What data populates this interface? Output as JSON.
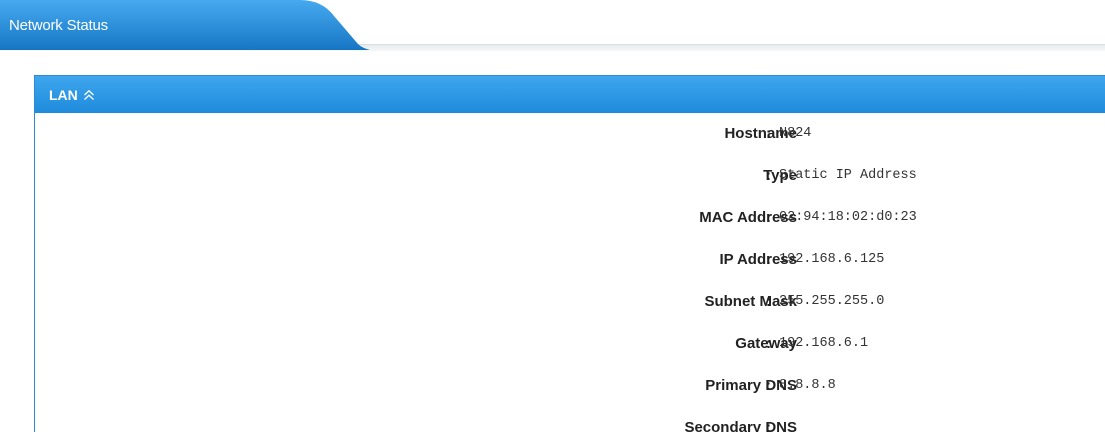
{
  "tab": {
    "label": "Network Status"
  },
  "panel": {
    "title": "LAN",
    "collapse_icon": "chevron-double-up-icon"
  },
  "colors": {
    "accent_blue": "#1e8bdc",
    "header_blue_light": "#3fa6ee",
    "tab_blue_dark": "#1a7cc7"
  },
  "fields": [
    {
      "label": "Hostname",
      "value": "N824"
    },
    {
      "label": "Type",
      "value": "Static IP Address"
    },
    {
      "label": "MAC Address",
      "value": "02:94:18:02:d0:23"
    },
    {
      "label": "IP Address",
      "value": "192.168.6.125"
    },
    {
      "label": "Subnet Mask",
      "value": "255.255.255.0"
    },
    {
      "label": "Gateway",
      "value": "192.168.6.1"
    },
    {
      "label": "Primary DNS",
      "value": "8.8.8.8"
    },
    {
      "label": "Secondary DNS",
      "value": ""
    }
  ],
  "separator": ":"
}
